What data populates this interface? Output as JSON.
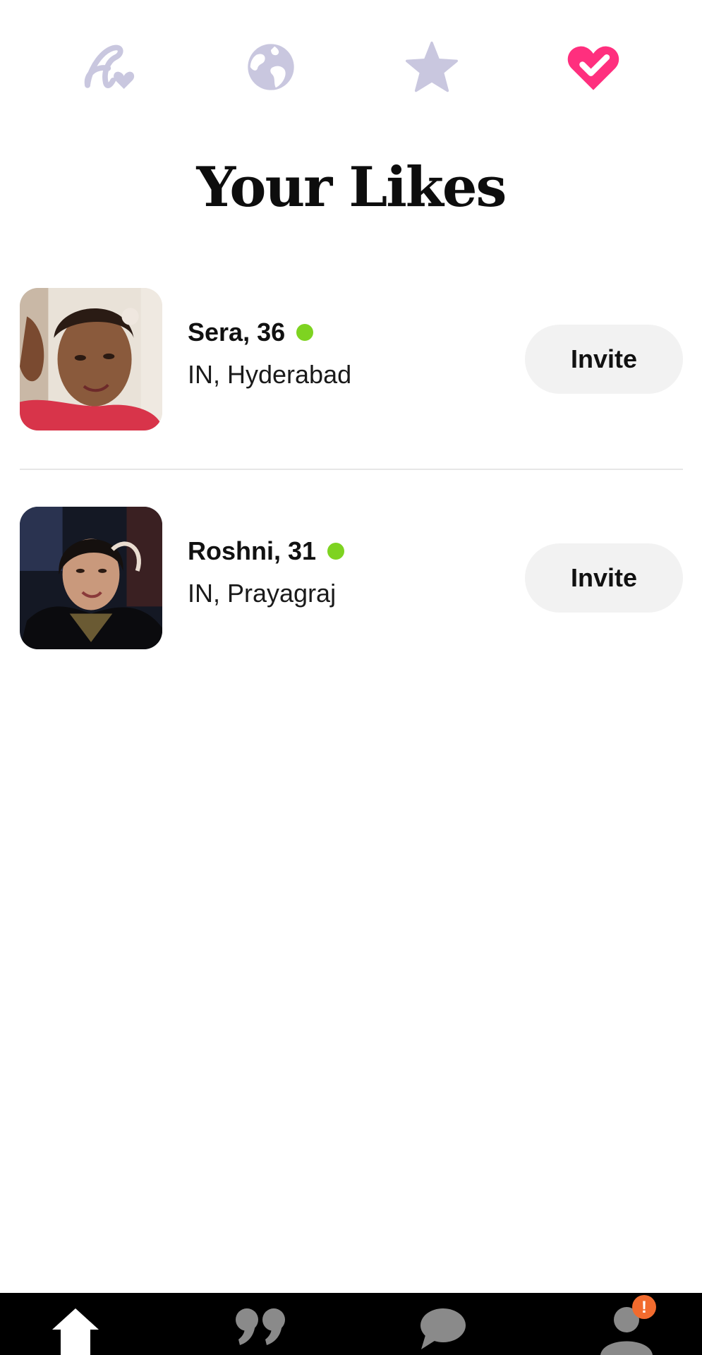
{
  "top_tabs": [
    {
      "icon": "signature-heart-icon",
      "active": false
    },
    {
      "icon": "globe-icon",
      "active": false
    },
    {
      "icon": "star-icon",
      "active": false
    },
    {
      "icon": "heart-check-icon",
      "active": true
    }
  ],
  "colors": {
    "inactive_icon": "#c9c7df",
    "active_icon": "#ff2f7e",
    "online": "#7ed321",
    "invite_bg": "#f2f2f2",
    "bottom_nav_bg": "#000000",
    "badge": "#f26b2e"
  },
  "page_title": "Your Likes",
  "likes": [
    {
      "name": "Sera, 36",
      "location": "IN, Hyderabad",
      "online": true,
      "invite_label": "Invite"
    },
    {
      "name": "Roshni, 31",
      "location": "IN, Prayagraj",
      "online": true,
      "invite_label": "Invite"
    }
  ],
  "bottom_nav": [
    {
      "icon": "home-icon",
      "active": true
    },
    {
      "icon": "quote-icon",
      "active": false
    },
    {
      "icon": "chat-bubble-icon",
      "active": false
    },
    {
      "icon": "profile-icon",
      "active": false,
      "badge": "!"
    }
  ]
}
